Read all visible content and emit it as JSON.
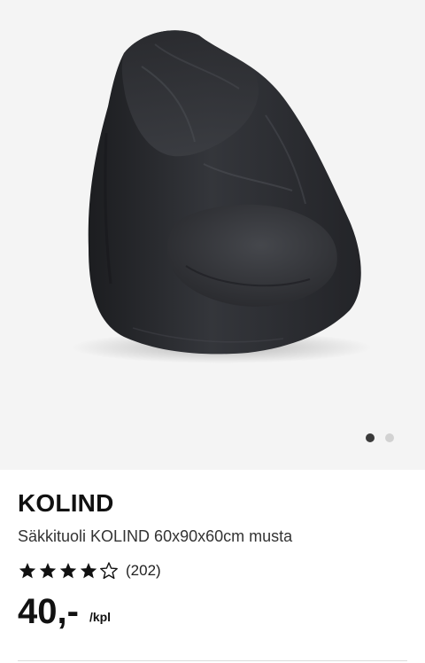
{
  "product": {
    "name": "KOLIND",
    "description": "Säkkituoli KOLIND 60x90x60cm musta",
    "rating": 4,
    "rating_max": 5,
    "review_count": "(202)",
    "price": "40,-",
    "price_unit": "/kpl",
    "image_icon": "bean-bag-chair-image"
  },
  "gallery": {
    "current_slide": 1,
    "total_slides": 2
  },
  "colors": {
    "gallery_background": "#f4f4f4",
    "dot_active": "#3a3a3a",
    "dot_inactive": "#d2d2d2",
    "star": "#111111"
  }
}
